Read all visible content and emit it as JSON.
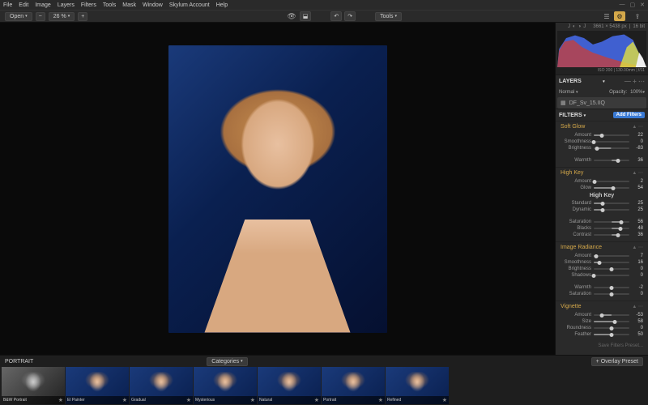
{
  "menubar": [
    "File",
    "Edit",
    "Image",
    "Layers",
    "Filters",
    "Tools",
    "Mask",
    "Window",
    "Skylum Account",
    "Help"
  ],
  "toolbar": {
    "open": "Open",
    "zoom": "26 %",
    "tools": "Tools"
  },
  "info": {
    "dims": "3661 × 5438 px",
    "iso": "ISO 200",
    "focal": "130.00mm",
    "f": "f/11",
    "bit": "16 bit"
  },
  "panels": {
    "layers": "LAYERS",
    "filters": "FILTERS"
  },
  "layer": {
    "blend": "Normal",
    "opacity_lbl": "Opacity:",
    "opacity": "100%",
    "name": "DF_Sv_15.IIQ"
  },
  "filters": {
    "add": "Add Filters",
    "sections": [
      {
        "name": "Soft Glow",
        "sliders": [
          {
            "lbl": "Amount",
            "val": 22,
            "pos": 22
          },
          {
            "lbl": "Smoothness",
            "val": 0,
            "pos": 0
          },
          {
            "lbl": "Brightness",
            "val": -83,
            "pos": 8,
            "center": true
          },
          {
            "lbl": "Warmth",
            "val": 36,
            "pos": 68,
            "center": true
          }
        ]
      },
      {
        "name": "High Key",
        "sub": "High Key",
        "sliders": [
          {
            "lbl": "Amount",
            "val": 2,
            "pos": 2
          },
          {
            "lbl": "Glow",
            "val": 54,
            "pos": 54
          },
          {
            "lbl": "Standard",
            "val": 25,
            "pos": 25
          },
          {
            "lbl": "Dynamic",
            "val": 25,
            "pos": 25
          },
          {
            "lbl": "Saturation",
            "val": 56,
            "pos": 78,
            "center": true,
            "sat": true
          },
          {
            "lbl": "Blacks",
            "val": 48,
            "pos": 74,
            "center": true
          },
          {
            "lbl": "Contrast",
            "val": 36,
            "pos": 68,
            "center": true
          }
        ]
      },
      {
        "name": "Image Radiance",
        "sliders": [
          {
            "lbl": "Amount",
            "val": 7,
            "pos": 7
          },
          {
            "lbl": "Smoothness",
            "val": 16,
            "pos": 16
          },
          {
            "lbl": "Brightness",
            "val": 0,
            "pos": 50,
            "center": true
          },
          {
            "lbl": "Shadows",
            "val": 0,
            "pos": 0
          },
          {
            "lbl": "Warmth",
            "val": -2,
            "pos": 49,
            "center": true
          },
          {
            "lbl": "Saturation",
            "val": 0,
            "pos": 50,
            "center": true
          }
        ]
      },
      {
        "name": "Vignette",
        "sliders": [
          {
            "lbl": "Amount",
            "val": -53,
            "pos": 23,
            "center": true
          },
          {
            "lbl": "Size",
            "val": 58,
            "pos": 58
          },
          {
            "lbl": "Roundness",
            "val": 0,
            "pos": 50,
            "center": true
          },
          {
            "lbl": "Feather",
            "val": 50,
            "pos": 50
          }
        ]
      }
    ],
    "save": "Save Filters Preset..."
  },
  "presets": {
    "title": "PORTRAIT",
    "categories": "Categories",
    "overlay": "+ Overlay Preset",
    "items": [
      "B&W Portrait",
      "El Painter",
      "Gradual",
      "Mysterious",
      "Natural",
      "Portrait",
      "Refined"
    ]
  }
}
